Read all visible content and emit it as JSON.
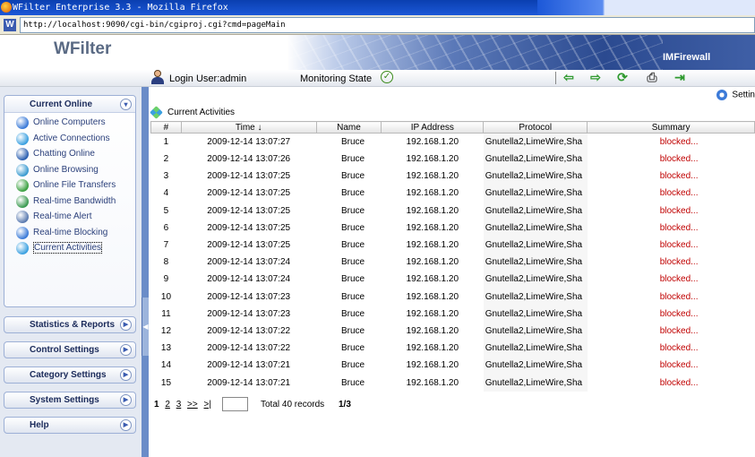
{
  "window": {
    "title": "WFilter Enterprise 3.3 - Mozilla Firefox"
  },
  "browser": {
    "url": "http://localhost:9090/cgi-bin/cgiproj.cgi?cmd=pageMain"
  },
  "banner": {
    "logo": "WFilter",
    "product": "IMFirewall"
  },
  "infobar": {
    "login_user": "Login User:admin",
    "monitoring_state": "Monitoring State"
  },
  "toolbar": {
    "icons": [
      "back-icon",
      "forward-icon",
      "refresh-icon",
      "print-icon",
      "logout-icon"
    ],
    "settings_label": "Settin"
  },
  "sidebar": {
    "current_online": {
      "title": "Current Online",
      "items": [
        {
          "label": "Online Computers",
          "icon": "computers-icon",
          "color": "#3a7ad8"
        },
        {
          "label": "Active Connections",
          "icon": "connections-icon",
          "color": "#3aa0e0"
        },
        {
          "label": "Chatting Online",
          "icon": "chat-icon",
          "color": "#2b5fb0"
        },
        {
          "label": "Online Browsing",
          "icon": "browser-icon",
          "color": "#3a9ad0"
        },
        {
          "label": "Online File Transfers",
          "icon": "file-transfer-icon",
          "color": "#3aa040"
        },
        {
          "label": "Real-time Bandwidth",
          "icon": "bandwidth-icon",
          "color": "#3a9a50"
        },
        {
          "label": "Real-time Alert",
          "icon": "alert-icon",
          "color": "#5a7ab0"
        },
        {
          "label": "Real-time Blocking",
          "icon": "blocking-icon",
          "color": "#3a7ad8"
        },
        {
          "label": "Current Activities",
          "icon": "activities-icon",
          "color": "#3aa0e0"
        }
      ]
    },
    "menus": [
      "Statistics & Reports",
      "Control Settings",
      "Category Settings",
      "System Settings",
      "Help"
    ]
  },
  "main": {
    "title": "Current Activities",
    "columns": [
      "#",
      "Time",
      "Name",
      "IP Address",
      "Protocol",
      "Summary"
    ],
    "sort_indicator": "↓",
    "rows": [
      {
        "n": "1",
        "time": "2009-12-14 13:07:27",
        "name": "Bruce",
        "ip": "192.168.1.20",
        "protocol": "Gnutella2,LimeWire,Sha",
        "summary": "blocked..."
      },
      {
        "n": "2",
        "time": "2009-12-14 13:07:26",
        "name": "Bruce",
        "ip": "192.168.1.20",
        "protocol": "Gnutella2,LimeWire,Sha",
        "summary": "blocked..."
      },
      {
        "n": "3",
        "time": "2009-12-14 13:07:25",
        "name": "Bruce",
        "ip": "192.168.1.20",
        "protocol": "Gnutella2,LimeWire,Sha",
        "summary": "blocked..."
      },
      {
        "n": "4",
        "time": "2009-12-14 13:07:25",
        "name": "Bruce",
        "ip": "192.168.1.20",
        "protocol": "Gnutella2,LimeWire,Sha",
        "summary": "blocked..."
      },
      {
        "n": "5",
        "time": "2009-12-14 13:07:25",
        "name": "Bruce",
        "ip": "192.168.1.20",
        "protocol": "Gnutella2,LimeWire,Sha",
        "summary": "blocked..."
      },
      {
        "n": "6",
        "time": "2009-12-14 13:07:25",
        "name": "Bruce",
        "ip": "192.168.1.20",
        "protocol": "Gnutella2,LimeWire,Sha",
        "summary": "blocked..."
      },
      {
        "n": "7",
        "time": "2009-12-14 13:07:25",
        "name": "Bruce",
        "ip": "192.168.1.20",
        "protocol": "Gnutella2,LimeWire,Sha",
        "summary": "blocked..."
      },
      {
        "n": "8",
        "time": "2009-12-14 13:07:24",
        "name": "Bruce",
        "ip": "192.168.1.20",
        "protocol": "Gnutella2,LimeWire,Sha",
        "summary": "blocked..."
      },
      {
        "n": "9",
        "time": "2009-12-14 13:07:24",
        "name": "Bruce",
        "ip": "192.168.1.20",
        "protocol": "Gnutella2,LimeWire,Sha",
        "summary": "blocked..."
      },
      {
        "n": "10",
        "time": "2009-12-14 13:07:23",
        "name": "Bruce",
        "ip": "192.168.1.20",
        "protocol": "Gnutella2,LimeWire,Sha",
        "summary": "blocked..."
      },
      {
        "n": "11",
        "time": "2009-12-14 13:07:23",
        "name": "Bruce",
        "ip": "192.168.1.20",
        "protocol": "Gnutella2,LimeWire,Sha",
        "summary": "blocked..."
      },
      {
        "n": "12",
        "time": "2009-12-14 13:07:22",
        "name": "Bruce",
        "ip": "192.168.1.20",
        "protocol": "Gnutella2,LimeWire,Sha",
        "summary": "blocked..."
      },
      {
        "n": "13",
        "time": "2009-12-14 13:07:22",
        "name": "Bruce",
        "ip": "192.168.1.20",
        "protocol": "Gnutella2,LimeWire,Sha",
        "summary": "blocked..."
      },
      {
        "n": "14",
        "time": "2009-12-14 13:07:21",
        "name": "Bruce",
        "ip": "192.168.1.20",
        "protocol": "Gnutella2,LimeWire,Sha",
        "summary": "blocked..."
      },
      {
        "n": "15",
        "time": "2009-12-14 13:07:21",
        "name": "Bruce",
        "ip": "192.168.1.20",
        "protocol": "Gnutella2,LimeWire,Sha",
        "summary": "blocked..."
      }
    ],
    "pagination": {
      "pages": [
        "1",
        "2",
        "3"
      ],
      "next": ">>",
      "last": ">|",
      "page_input": "",
      "total": "Total 40 records",
      "position": "1/3"
    }
  },
  "colors": {
    "blocked": "#c00000",
    "sidebar_strip": "#6a8cc8",
    "title_bar": "#0a3fb0"
  }
}
